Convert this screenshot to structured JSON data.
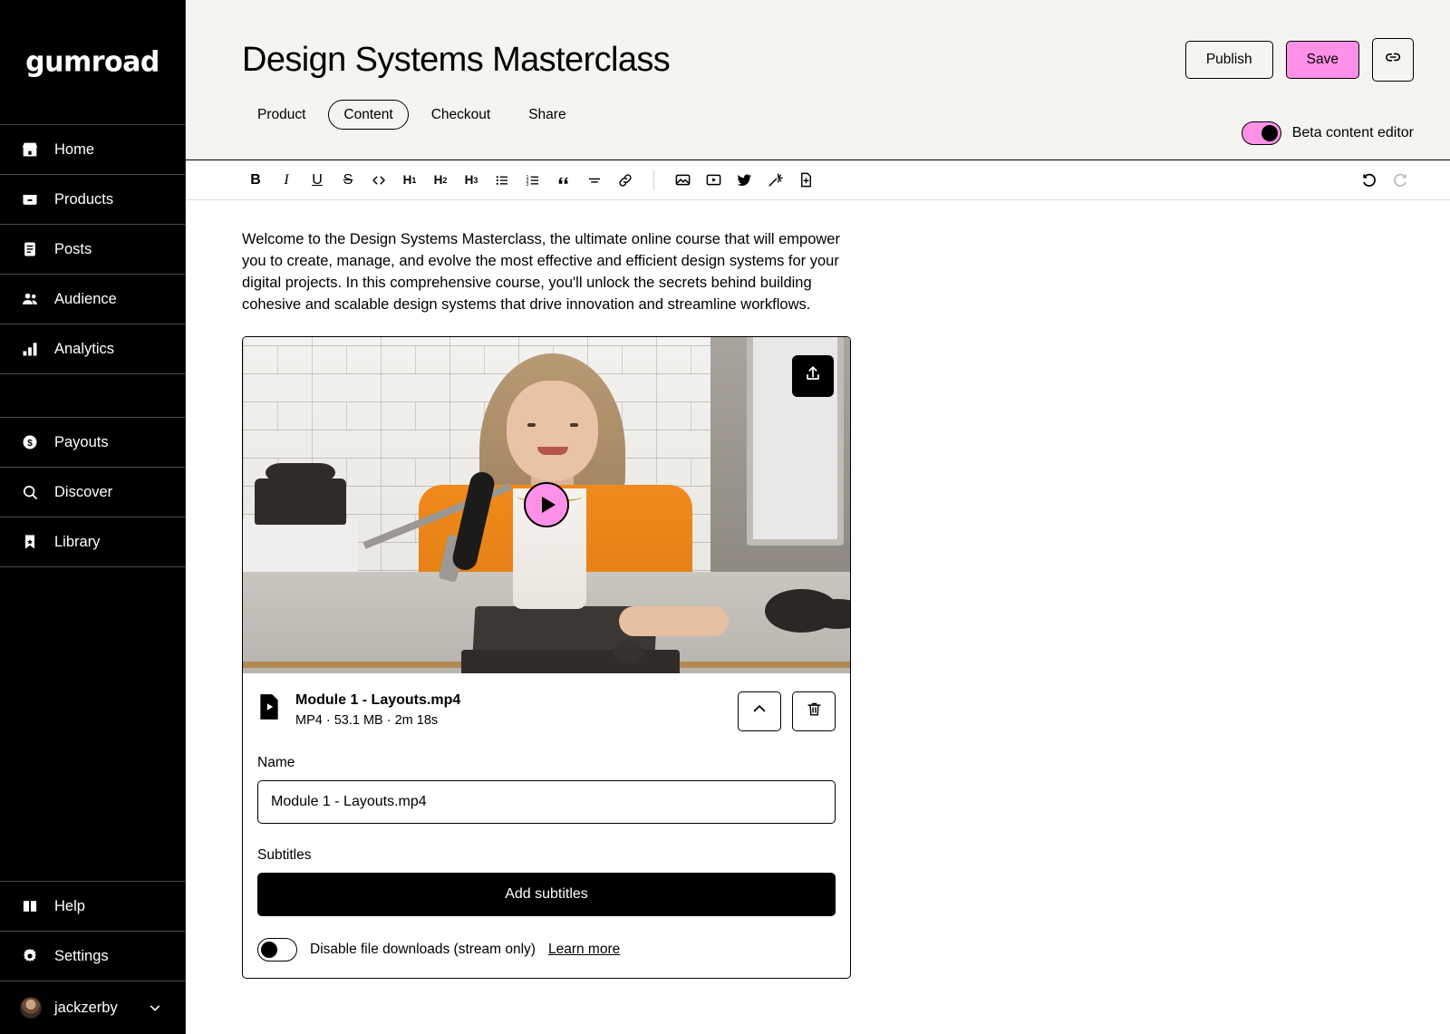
{
  "sidebar": {
    "brand": "gumroad",
    "items": [
      {
        "label": "Home",
        "icon": "home-icon"
      },
      {
        "label": "Products",
        "icon": "products-icon"
      },
      {
        "label": "Posts",
        "icon": "posts-icon"
      },
      {
        "label": "Audience",
        "icon": "audience-icon"
      },
      {
        "label": "Analytics",
        "icon": "analytics-icon"
      },
      {
        "label": "",
        "icon": "spacer"
      },
      {
        "label": "Payouts",
        "icon": "payouts-icon"
      },
      {
        "label": "Discover",
        "icon": "discover-icon"
      },
      {
        "label": "Library",
        "icon": "library-icon"
      }
    ],
    "bottom": [
      {
        "label": "Help",
        "icon": "help-icon"
      },
      {
        "label": "Settings",
        "icon": "gear-icon"
      }
    ],
    "user": {
      "name": "jackzerby",
      "chevron": "chevron-down-icon"
    }
  },
  "header": {
    "title": "Design Systems Masterclass",
    "tabs": [
      {
        "label": "Product",
        "active": false
      },
      {
        "label": "Content",
        "active": true
      },
      {
        "label": "Checkout",
        "active": false
      },
      {
        "label": "Share",
        "active": false
      }
    ],
    "actions": {
      "publish_label": "Publish",
      "save_label": "Save",
      "link_icon": "link-icon"
    },
    "beta_toggle": {
      "label": "Beta content editor",
      "state": "on"
    }
  },
  "toolbar": {
    "groups": [
      [
        "bold-icon",
        "italic-icon",
        "underline-icon",
        "strikethrough-icon",
        "code-icon",
        "heading-1-icon",
        "heading-2-icon",
        "heading-3-icon",
        "bullet-list-icon",
        "numbered-list-icon",
        "blockquote-icon",
        "horizontal-rule-icon",
        "link-icon"
      ],
      [
        "image-icon",
        "video-icon",
        "twitter-icon",
        "sparkle-icon",
        "file-upload-icon"
      ]
    ],
    "history": [
      {
        "icon": "undo-icon",
        "enabled": true
      },
      {
        "icon": "redo-icon",
        "enabled": false
      }
    ]
  },
  "document": {
    "paragraph": "Welcome to the Design Systems Masterclass, the ultimate online course that will empower you to create, manage, and evolve the most effective and efficient design systems for your digital projects. In this comprehensive course, you'll unlock the secrets behind building cohesive and scalable design systems that drive innovation and streamline workflows.",
    "file_block": {
      "thumbnail_alt": "Woman in orange jacket at desk with podcast microphone",
      "play_icon": "play-icon",
      "upload_icon": "upload-icon",
      "file_icon": "video-file-icon",
      "file_name": "Module 1 - Layouts.mp4",
      "file_meta": "MP4 · 53.1 MB · 2m 18s",
      "collapse_icon": "chevron-up-icon",
      "delete_icon": "trash-icon",
      "name_label": "Name",
      "name_value": "Module 1 - Layouts.mp4",
      "name_placeholder": "Name",
      "subtitles_label": "Subtitles",
      "add_subtitles_label": "Add subtitles",
      "disable_downloads_label": "Disable file downloads (stream only)",
      "learn_more_label": "Learn more",
      "disable_downloads_state": "off"
    }
  },
  "colors": {
    "brand_pink": "#FF90E8",
    "cream": "#F4F4F0",
    "black": "#000000"
  }
}
